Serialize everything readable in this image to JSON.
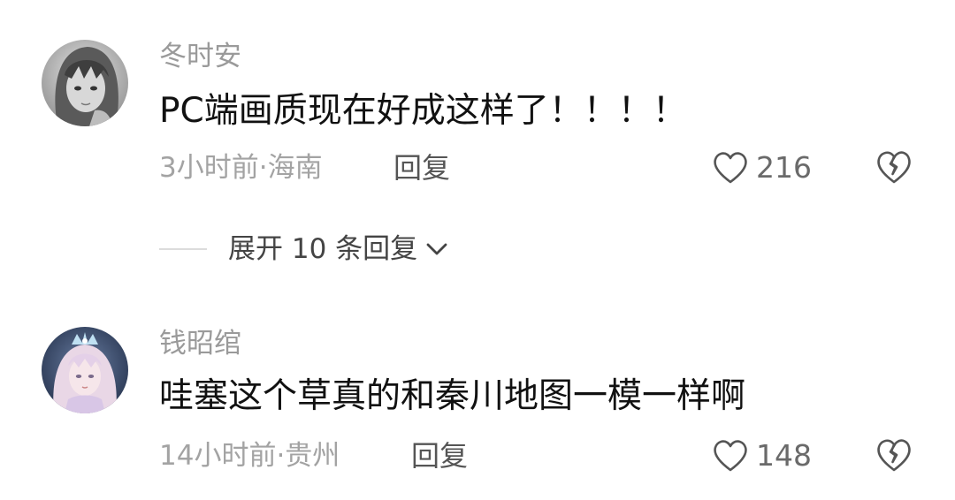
{
  "comments": [
    {
      "username": "冬时安",
      "text": "PC端画质现在好成这样了！！！！",
      "meta": "3小时前·海南",
      "reply_label": "回复",
      "likes": "216",
      "expand_replies": {
        "label": "展开 10 条回复"
      }
    },
    {
      "username": "钱昭绾",
      "text": "哇塞这个草真的和秦川地图一模一样啊",
      "meta": "14小时前·贵州",
      "reply_label": "回复",
      "likes": "148"
    }
  ],
  "icons": {
    "like": "heart-outline-icon",
    "dislike": "broken-heart-icon",
    "expand": "chevron-down-icon"
  },
  "colors": {
    "username": "#9a9a9a",
    "text": "#111111",
    "meta": "#a3a3a3",
    "icon": "#555555"
  }
}
